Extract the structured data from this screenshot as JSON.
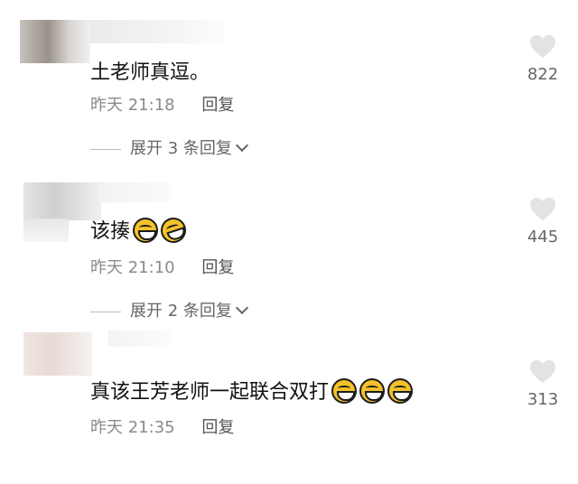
{
  "comments": [
    {
      "text": "土老师真逗。",
      "time": "昨天 21:18",
      "reply_label": "回复",
      "expand_label": "展开 3 条回复",
      "likes": "822",
      "emojis": []
    },
    {
      "text": "该揍",
      "time": "昨天 21:10",
      "reply_label": "回复",
      "expand_label": "展开 2 条回复",
      "likes": "445",
      "emojis": [
        "grin-emoji",
        "laughing-emoji"
      ]
    },
    {
      "text": "真该王芳老师一起联合双打",
      "time": "昨天 21:35",
      "reply_label": "回复",
      "likes": "313",
      "emojis": [
        "grin-emoji",
        "grin-emoji",
        "grin-emoji"
      ]
    }
  ],
  "icons": {
    "like": "heart-icon",
    "expand": "chevron-down-icon"
  },
  "colors": {
    "text": "#111111",
    "meta": "#8a8a8a",
    "heart": "#e3e3e3"
  }
}
